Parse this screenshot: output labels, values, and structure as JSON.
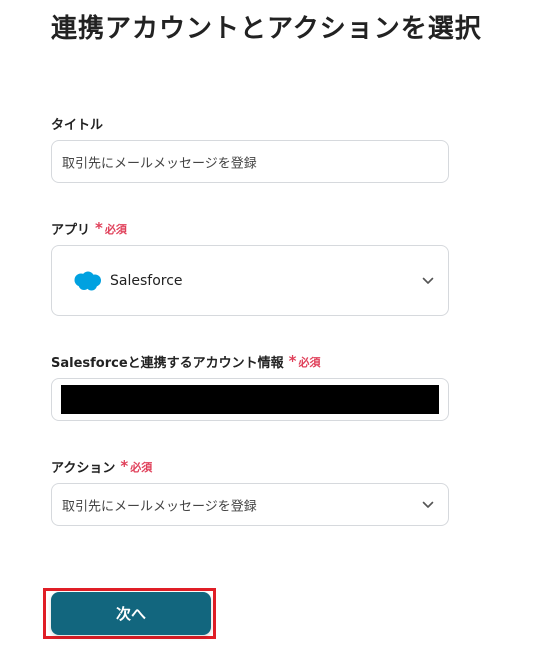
{
  "page": {
    "title": "連携アカウントとアクションを選択"
  },
  "required_text": "必須",
  "fields": {
    "title": {
      "label": "タイトル",
      "value": "取引先にメールメッセージを登録"
    },
    "app": {
      "label": "アプリ",
      "selected_app": "Salesforce",
      "app_icon": "salesforce-cloud-icon"
    },
    "account": {
      "label": "Salesforceと連携するアカウント情報",
      "value_redacted": true
    },
    "action": {
      "label": "アクション",
      "selected_value": "取引先にメールメッセージを登録"
    }
  },
  "buttons": {
    "next_label": "次へ"
  },
  "colors": {
    "primary_button": "#12667e",
    "required": "#e0405a",
    "highlight_border": "#e01e26",
    "salesforce_blue": "#00a1e0"
  }
}
